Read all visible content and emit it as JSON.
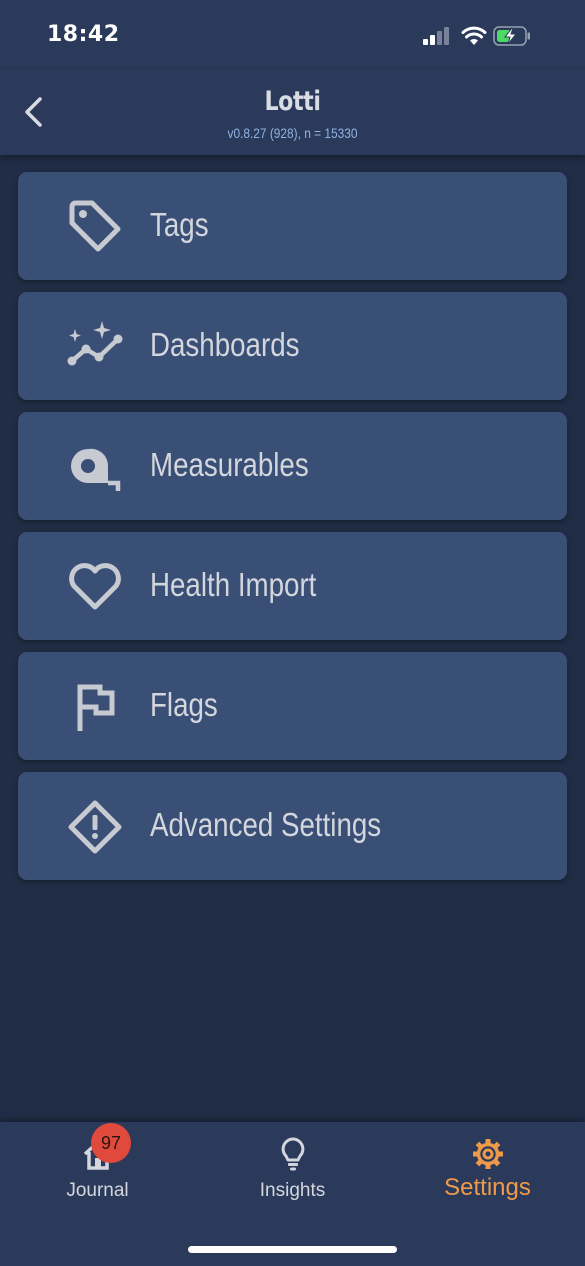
{
  "status_bar": {
    "time": "18:42",
    "icons": [
      "signal-icon",
      "wifi-icon",
      "battery-charging-icon"
    ],
    "battery_color": "#4cd964"
  },
  "app_bar": {
    "back_icon": "chevron-left-icon",
    "title": "Lotti",
    "subtitle": "v0.8.27 (928), n = 15330"
  },
  "menu": {
    "items": [
      {
        "label": "Tags",
        "icon": "tag-icon"
      },
      {
        "label": "Dashboards",
        "icon": "dashboard-sparkline-icon"
      },
      {
        "label": "Measurables",
        "icon": "tape-measure-icon"
      },
      {
        "label": "Health Import",
        "icon": "heart-icon"
      },
      {
        "label": "Flags",
        "icon": "flag-icon"
      },
      {
        "label": "Advanced Settings",
        "icon": "warning-diamond-icon"
      }
    ]
  },
  "bottom_nav": {
    "items": [
      {
        "label": "Journal",
        "icon": "home-icon",
        "badge": "97"
      },
      {
        "label": "Insights",
        "icon": "lightbulb-icon"
      },
      {
        "label": "Settings",
        "icon": "gear-icon",
        "active": true
      }
    ]
  },
  "colors": {
    "background": "#212d46",
    "bar": "#2b3a5a",
    "card": "#3a4f76",
    "accent": "#ef9a4a",
    "subtitle": "#8fb3e3",
    "badge": "#e04a3d"
  }
}
